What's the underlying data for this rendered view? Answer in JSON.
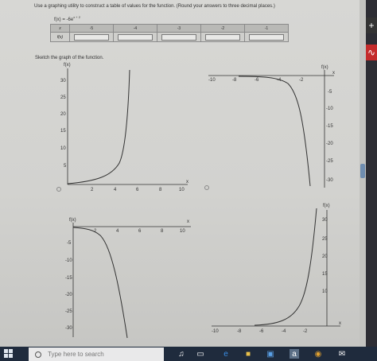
{
  "problem": {
    "instruction": "Use a graphing utility to construct a table of values for the function. (Round your answers to three decimal places.)",
    "function_prefix": "f(x) = -6e",
    "function_exponent": "x + 2"
  },
  "table": {
    "x_header": "x",
    "fx_header": "f(x)",
    "x_values": [
      "-5",
      "-4",
      "-3",
      "-2",
      "-1"
    ]
  },
  "sketch_instruction": "Sketch the graph of the function.",
  "graphs": {
    "fx_label": "f(x)",
    "x_label": "x",
    "g1": {
      "y_ticks": [
        "30",
        "25",
        "20",
        "15",
        "10",
        "5"
      ],
      "x_ticks": [
        "2",
        "4",
        "6",
        "8",
        "10"
      ]
    },
    "g2": {
      "x_ticks": [
        "-10",
        "-8",
        "-6",
        "-4",
        "-2"
      ],
      "y_ticks": [
        "-5",
        "-10",
        "-15",
        "-20",
        "-25",
        "-30"
      ]
    },
    "g3": {
      "x_ticks": [
        "2",
        "4",
        "6",
        "8",
        "10"
      ],
      "y_ticks": [
        "-5",
        "-10",
        "-15",
        "-20",
        "-25",
        "-30"
      ]
    },
    "g4": {
      "y_ticks": [
        "30",
        "25",
        "20",
        "15",
        "10"
      ],
      "x_ticks": [
        "-10",
        "-8",
        "-6",
        "-4",
        "-2"
      ]
    }
  },
  "taskbar": {
    "search_placeholder": "Type here to search"
  },
  "colors": {
    "taskbar": "#1f2b3d",
    "accent_red": "#c42b2b",
    "page": "#d4d4d1"
  },
  "icons": [
    "windows-start-icon",
    "search-icon",
    "microphone-icon",
    "task-view-icon",
    "edge-icon",
    "file-explorer-icon",
    "store-icon",
    "amazon-icon",
    "chrome-icon",
    "mail-icon"
  ]
}
